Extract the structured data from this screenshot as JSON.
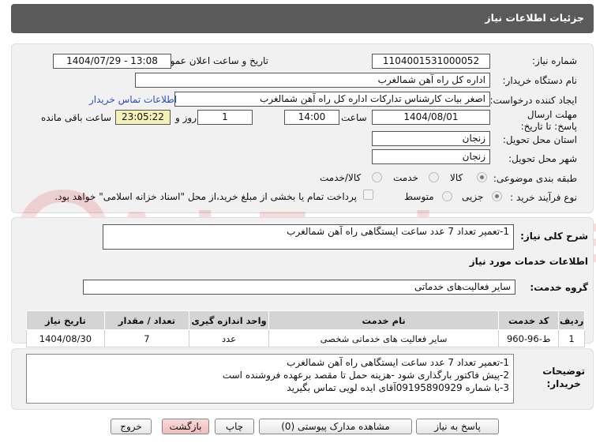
{
  "header": {
    "title": "جزئیات اطلاعات نیاز"
  },
  "details": {
    "need_number_label": "شماره نیاز:",
    "need_number": "1104001531000052",
    "announce_label": "تاریخ و ساعت اعلان عمومی:",
    "announce_value": "1404/07/29 - 13:08",
    "buyer_org_label": "نام دستگاه خریدار:",
    "buyer_org": "اداره کل راه آهن شمالغرب",
    "creator_label": "ایجاد کننده درخواست:",
    "creator": "اصغر بیات کارشناس تداركات اداره كل راه آهن شمالغرب",
    "contact_link": "اطلاعات تماس خریدار",
    "deadline_label": "مهلت ارسال پاسخ: تا تاریخ:",
    "deadline_date": "1404/08/01",
    "time_label": "ساعت",
    "deadline_time": "14:00",
    "days_value": "1",
    "days_label": "روز و",
    "remaining_time": "23:05:22",
    "remaining_label": "ساعت باقی مانده",
    "province_label": "استان محل تحویل:",
    "province": "زنجان",
    "city_label": "شهر محل تحویل:",
    "city": "زنجان",
    "category_label": "طبقه بندی موضوعی:",
    "category_options": [
      "کالا",
      "خدمت",
      "کالا/خدمت"
    ],
    "process_label": "نوع فرآیند خرید :",
    "process_options": [
      "جزیی",
      "متوسط"
    ],
    "payment_note": "پرداخت تمام یا بخشی از مبلغ خرید،از محل \"اسناد خزانه اسلامی\" خواهد بود."
  },
  "summary": {
    "label": "شرح کلی نیاز:",
    "text": "1-تعمیر تعداد 7 عدد ساعت ایستگاهی راه آهن شمالغرب"
  },
  "services": {
    "section_title": "اطلاعات خدمات مورد نیاز",
    "group_label": "گروه خدمت:",
    "group_value": "سایر فعالیت‌های خدماتی",
    "columns": [
      "ردیف",
      "کد خدمت",
      "نام خدمت",
      "واحد اندازه گیری",
      "تعداد / مقدار",
      "تاریخ نیاز"
    ],
    "rows": [
      [
        "1",
        "ط-96-960",
        "سایر فعالیت های خدماتی شخصی",
        "عدد",
        "7",
        "1404/08/30"
      ]
    ]
  },
  "buyer_notes": {
    "label_line1": "توضیحات",
    "label_line2": "خریدار:",
    "lines": [
      "1-تعمیر تعداد 7 عدد ساعت ایستگاهی راه آهن شمالغرب",
      "2-پیش فاکتور بارگذاری شود -هزینه حمل تا مقصد برعهده فروشنده است",
      "3-با شماره  09195890929آقای ایده لویی تماس بگیرید"
    ]
  },
  "buttons": {
    "reply": "پاسخ به نیاز",
    "attachments": "مشاهده مدارک پیوستی (0)",
    "print": "چاپ",
    "back": "بازگشت",
    "exit": "خروج"
  },
  "watermark": {
    "text": "AriaTender.net"
  },
  "colors": {
    "header_bg": "#5a5a5a",
    "panel_bg": "#f1f1f1",
    "link": "#2a4fbf",
    "remaining_bg": "#f4f1b5",
    "back_btn": "#f4c7c7"
  }
}
